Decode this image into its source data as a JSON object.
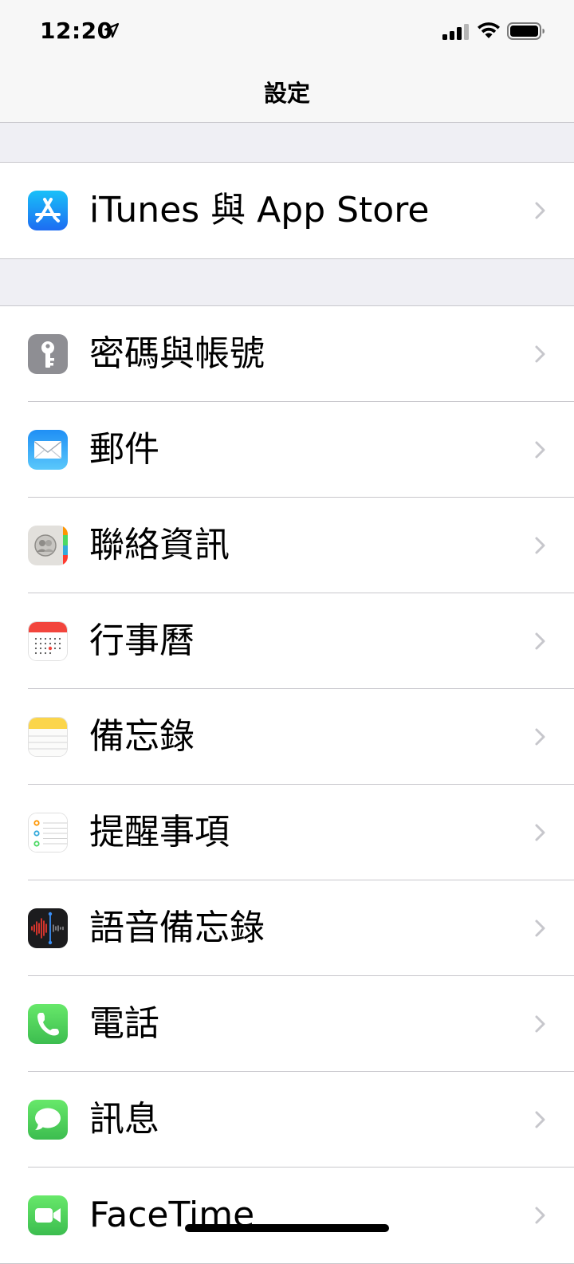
{
  "status_bar": {
    "time": "12:20"
  },
  "nav": {
    "title": "設定"
  },
  "groups": [
    {
      "items": [
        {
          "label": "iTunes 與 App Store",
          "icon": "app-store-icon"
        }
      ]
    },
    {
      "items": [
        {
          "label": "密碼與帳號",
          "icon": "key-icon"
        },
        {
          "label": "郵件",
          "icon": "mail-icon"
        },
        {
          "label": "聯絡資訊",
          "icon": "contacts-icon"
        },
        {
          "label": "行事曆",
          "icon": "calendar-icon"
        },
        {
          "label": "備忘錄",
          "icon": "notes-icon"
        },
        {
          "label": "提醒事項",
          "icon": "reminders-icon"
        },
        {
          "label": "語音備忘錄",
          "icon": "voice-memos-icon"
        },
        {
          "label": "電話",
          "icon": "phone-icon"
        },
        {
          "label": "訊息",
          "icon": "messages-icon"
        },
        {
          "label": "FaceTime",
          "icon": "facetime-icon"
        }
      ]
    }
  ],
  "colors": {
    "app_store": "#2e8ef7",
    "key": "#8e8e93",
    "mail": "#3c8ff5",
    "phone": "#4cd964",
    "messages": "#4cd964",
    "facetime": "#4cd964",
    "voice_memos": "#1c1c1e",
    "calendar_red": "#f2453d",
    "notes_yellow": "#fbd54b"
  }
}
